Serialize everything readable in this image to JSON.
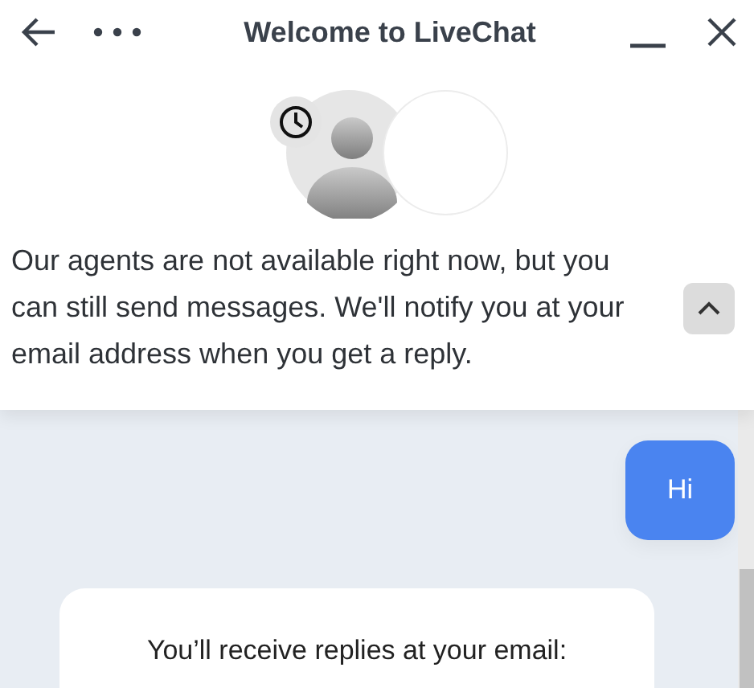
{
  "header": {
    "title": "Welcome to LiveChat"
  },
  "notice": {
    "text": "Our agents are not available right now, but you can still send messages. We'll notify you at your email address when you get a reply.",
    "expanded": true
  },
  "messages": [
    {
      "kind": "visitor",
      "text": "Hi"
    },
    {
      "kind": "system",
      "text": "You’ll receive replies at your email:"
    }
  ]
}
